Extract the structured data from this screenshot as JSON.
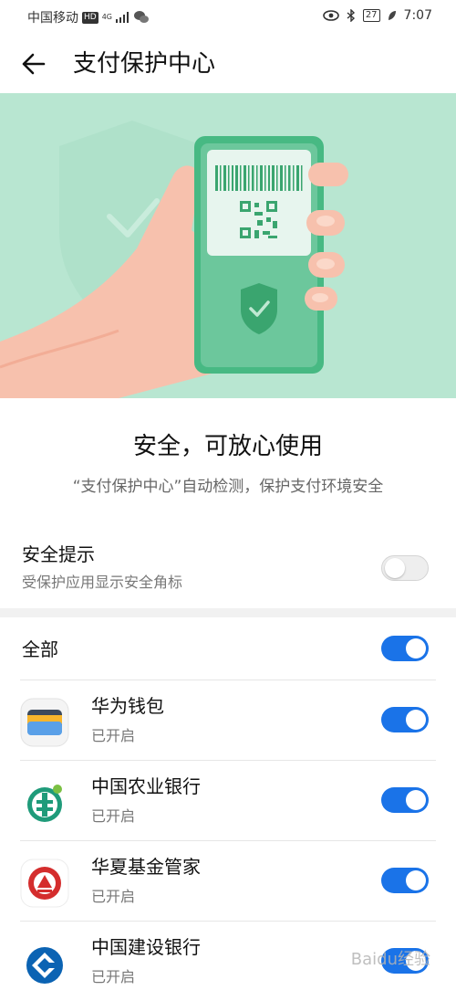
{
  "status_bar": {
    "carrier": "中国移动",
    "hd": "HD",
    "network": "4G",
    "battery": "27",
    "time": "7:07"
  },
  "header": {
    "title": "支付保护中心"
  },
  "hero": {
    "icons": [
      "shield-check-icon",
      "phone-qr-icon",
      "hand"
    ]
  },
  "intro": {
    "headline": "安全，可放心使用",
    "description": "“支付保护中心”自动检测，保护支付环境安全"
  },
  "safety_tip": {
    "title": "安全提示",
    "subtitle": "受保护应用显示安全角标",
    "enabled": false
  },
  "all": {
    "label": "全部",
    "enabled": true
  },
  "apps": [
    {
      "name": "华为钱包",
      "status": "已开启",
      "enabled": true,
      "icon": "wallet-icon"
    },
    {
      "name": "中国农业银行",
      "status": "已开启",
      "enabled": true,
      "icon": "abc-bank-icon"
    },
    {
      "name": "华夏基金管家",
      "status": "已开启",
      "enabled": true,
      "icon": "huaxia-fund-icon"
    },
    {
      "name": "中国建设银行",
      "status": "已开启",
      "enabled": true,
      "icon": "ccb-bank-icon"
    }
  ],
  "watermark": "Baidu经验",
  "colors": {
    "accent": "#1a73e8",
    "hero_bg": "#b8e6d1",
    "brand_green": "#3bb57e"
  }
}
